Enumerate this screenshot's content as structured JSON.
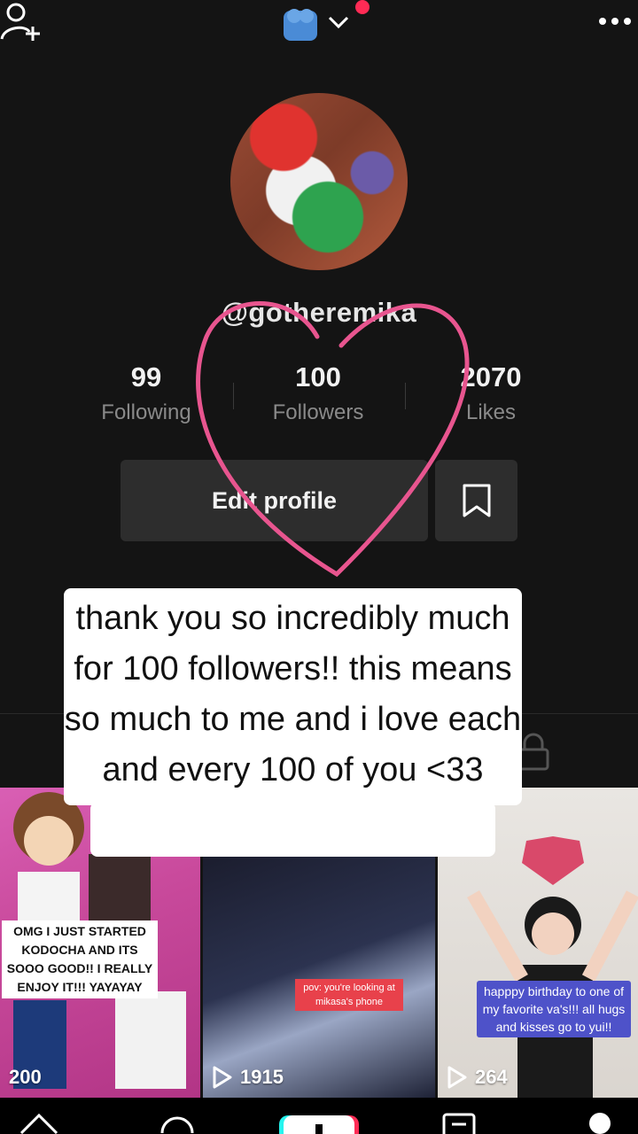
{
  "header": {
    "add_user_icon": "person-plus-icon",
    "account_icon": "account-switch-icon",
    "more_icon": "ellipsis-icon"
  },
  "profile": {
    "username": "@gotheremika",
    "stats": [
      {
        "value": "99",
        "label": "Following"
      },
      {
        "value": "100",
        "label": "Followers"
      },
      {
        "value": "2070",
        "label": "Likes"
      }
    ],
    "edit_label": "Edit profile"
  },
  "overlay": {
    "caption": "thank you so incredibly much for 100 followers!! this means so much to me and i love each and every 100 of you <33",
    "heart_color": "#e8558f"
  },
  "videos": [
    {
      "caption": "OMG I JUST STARTED KODOCHA AND ITS SOOO GOOD!! I REALLY ENJOY IT!!! YAYAYAY",
      "views": "200"
    },
    {
      "caption": "pov: you're looking at mikasa's phone",
      "views": "1915"
    },
    {
      "caption": "happpy birthday to one of my favorite va's!!! all hugs and kisses go to yui!!",
      "views": "264"
    }
  ],
  "colors": {
    "background": "#141414",
    "accent": "#ff2b55"
  }
}
